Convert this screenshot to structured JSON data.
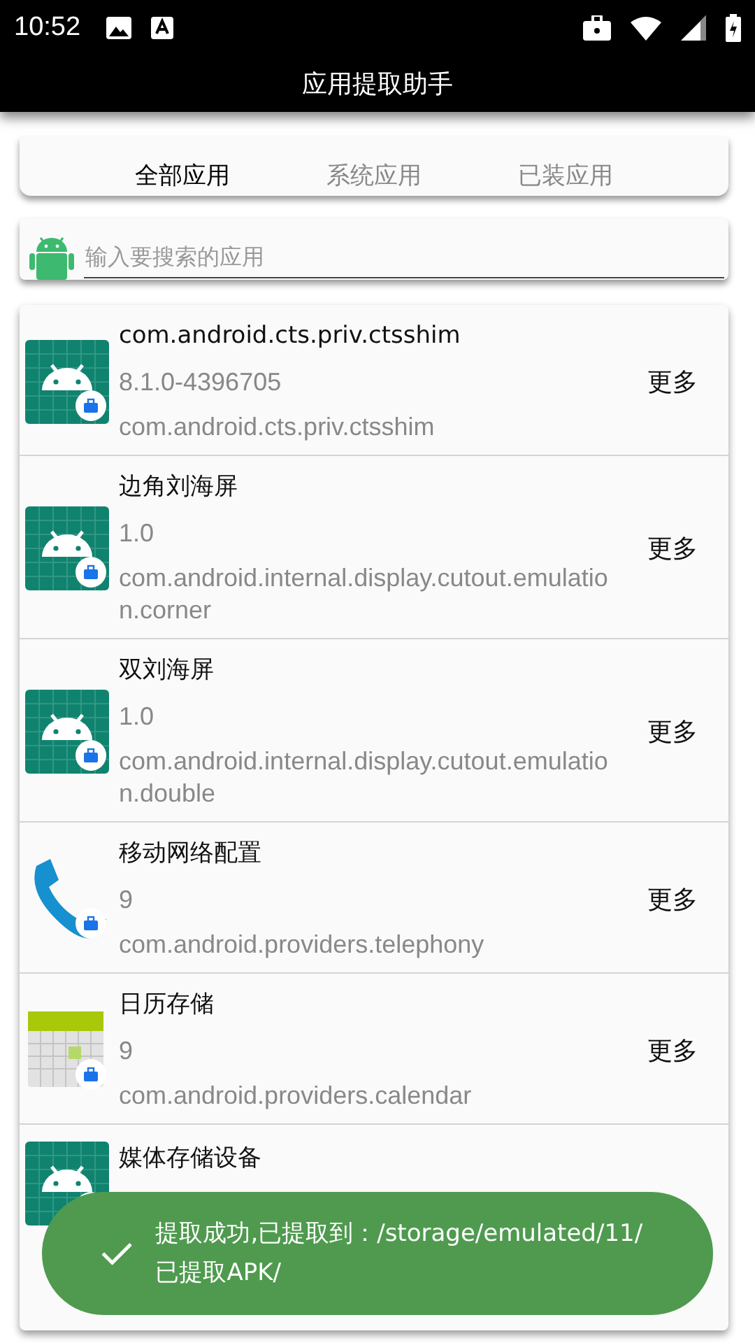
{
  "status_bar": {
    "time": "10:52"
  },
  "app_bar": {
    "title": "应用提取助手"
  },
  "tabs": [
    {
      "label": "全部应用",
      "selected": true
    },
    {
      "label": "系统应用",
      "selected": false
    },
    {
      "label": "已装应用",
      "selected": false
    }
  ],
  "search": {
    "placeholder": "输入要搜索的应用"
  },
  "apps": [
    {
      "kind": "android",
      "name": "com.android.cts.priv.ctsshim",
      "version": "8.1.0-4396705",
      "package": "com.android.cts.priv.ctsshim",
      "action": "更多"
    },
    {
      "kind": "android",
      "name": "边角刘海屏",
      "version": "1.0",
      "package": "com.android.internal.display.cutout.emulation.corner",
      "action": "更多"
    },
    {
      "kind": "android",
      "name": "双刘海屏",
      "version": "1.0",
      "package": "com.android.internal.display.cutout.emulation.double",
      "action": "更多"
    },
    {
      "kind": "phone",
      "name": "移动网络配置",
      "version": "9",
      "package": "com.android.providers.telephony",
      "action": "更多"
    },
    {
      "kind": "calendar",
      "name": "日历存储",
      "version": "9",
      "package": "com.android.providers.calendar",
      "action": "更多"
    },
    {
      "kind": "android",
      "name": "媒体存储设备"
    }
  ],
  "toast": {
    "message": "提取成功,已提取到：/storage/emulated/11/已提取APK/"
  }
}
